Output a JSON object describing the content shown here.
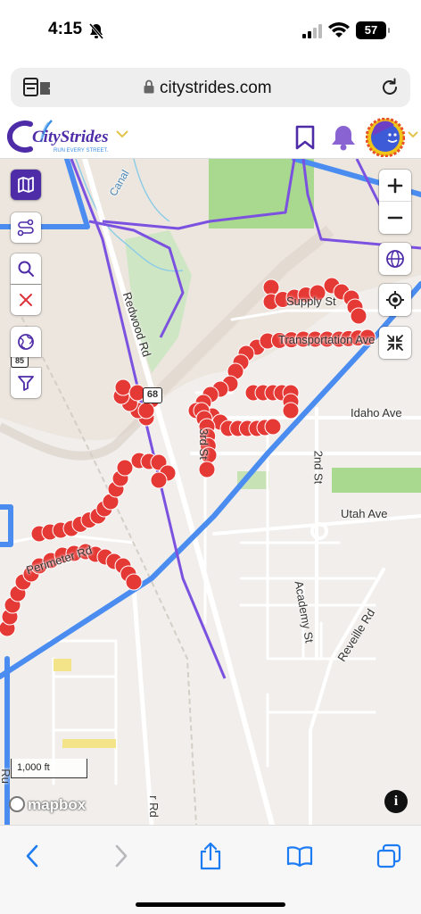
{
  "status": {
    "time": "4:15",
    "battery": "57"
  },
  "browser": {
    "url": "citystrides.com"
  },
  "site": {
    "logo_text": "CityStrides",
    "tagline": "RUN EVERY STREET."
  },
  "map": {
    "labels": {
      "canal": "Canal",
      "redwood": "Redwood Rd",
      "supply": "Supply St",
      "transportation": "Transportation Ave",
      "idaho": "Idaho Ave",
      "third": "3rd St",
      "second": "2nd St",
      "utah": "Utah Ave",
      "perimeter": "Perimeter Rd",
      "academy": "Academy St",
      "reveille": "Reveille Rd",
      "ru": "Ru",
      "r_rd": "r Rd",
      "route68": "68",
      "route85": "85"
    },
    "scale": "1,000 ft",
    "attribution": "mapbox"
  },
  "colors": {
    "brand": "#4e2ca8",
    "route": "#4a8cf0",
    "node": "#e53935",
    "accent": "#f0c419",
    "ios_blue": "#1e7cf2"
  }
}
